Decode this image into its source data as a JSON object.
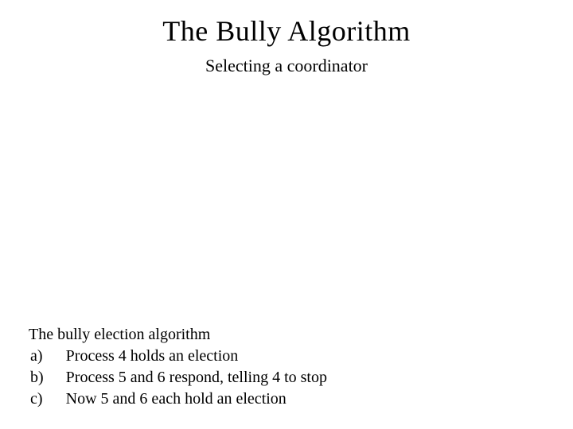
{
  "title": "The Bully Algorithm",
  "subtitle": "Selecting a coordinator",
  "intro": "The bully election algorithm",
  "items": [
    {
      "label": "a)",
      "text": "Process 4 holds an election"
    },
    {
      "label": "b)",
      "text": "Process 5 and 6 respond, telling 4 to stop"
    },
    {
      "label": "c)",
      "text": "Now 5 and 6 each hold an election"
    }
  ]
}
